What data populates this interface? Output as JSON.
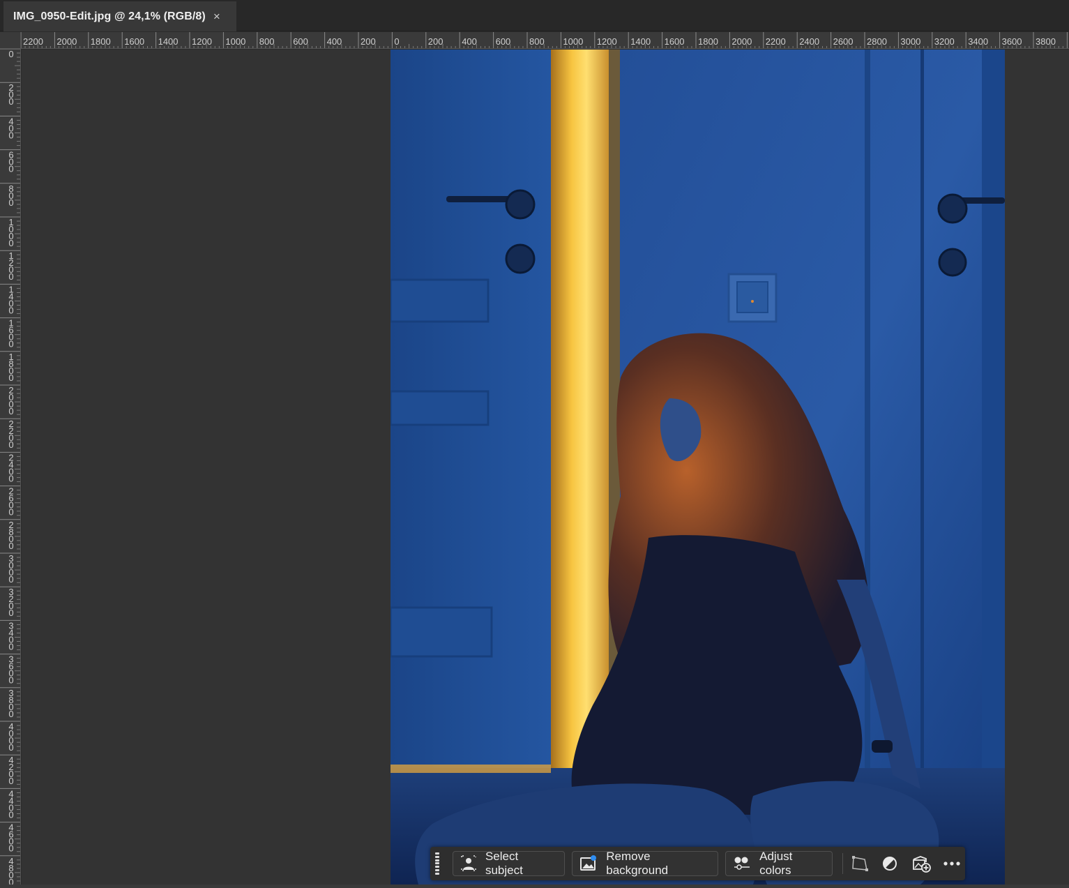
{
  "document_tab": {
    "title": "IMG_0950-Edit.jpg @ 24,1% (RGB/8)",
    "close_glyph": "×"
  },
  "ruler_horizontal": {
    "labels": [
      "2200",
      "2000",
      "1800",
      "1600",
      "1400",
      "1200",
      "1000",
      "800",
      "600",
      "400",
      "200",
      "0",
      "200",
      "400",
      "600",
      "800",
      "1000",
      "1200",
      "1400",
      "1600",
      "1800",
      "2000",
      "2200",
      "2400",
      "2600",
      "2800",
      "3000",
      "3200",
      "3400",
      "3600",
      "3800",
      "4"
    ]
  },
  "ruler_vertical": {
    "labels": [
      "0",
      "200",
      "400",
      "600",
      "800",
      "1000",
      "1200",
      "1400",
      "1600",
      "1800",
      "2000",
      "2200",
      "2400",
      "2600",
      "2800",
      "3000",
      "3200",
      "3400",
      "3600",
      "3800",
      "4000",
      "4200",
      "4400",
      "4600",
      "4800"
    ]
  },
  "taskbar": {
    "select_subject": "Select subject",
    "remove_background": "Remove background",
    "adjust_colors": "Adjust colors",
    "icons": [
      "grip-icon",
      "person-select-icon",
      "image-remove-bg-icon",
      "adjust-colors-icon",
      "transform-icon",
      "contrast-icon",
      "add-image-icon",
      "more-icon"
    ]
  },
  "colors": {
    "workspace": "#333333",
    "panel": "#2e2e2e",
    "photo_blue": "#1d4e96",
    "light_yellow": "#f7c440"
  }
}
